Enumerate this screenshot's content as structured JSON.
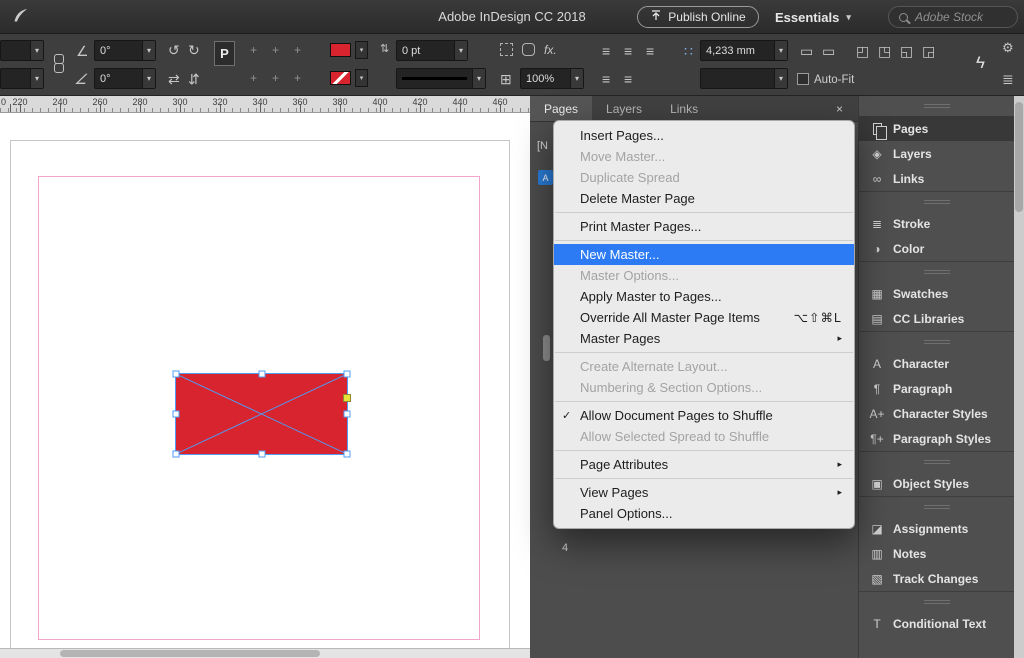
{
  "titlebar": {
    "title": "Adobe InDesign CC 2018",
    "publish_button": "Publish Online",
    "workspace": "Essentials",
    "stock_search_placeholder": "Adobe Stock"
  },
  "toolbar": {
    "rotation_angle": "0°",
    "shear_angle": "0°",
    "reference_badge": "P",
    "stroke_weight": "0 pt",
    "zoom_level": "100%",
    "corner_size": "4,233 mm",
    "autofit_label": "Auto-Fit",
    "effects_label": "fx."
  },
  "ruler": {
    "ticks": [
      "0",
      "220",
      "240",
      "260",
      "280",
      "300",
      "320",
      "340",
      "360",
      "380",
      "400",
      "420",
      "440",
      "460"
    ]
  },
  "menu": {
    "items": [
      {
        "label": "Insert Pages...",
        "state": "normal"
      },
      {
        "label": "Move Master...",
        "state": "disabled"
      },
      {
        "label": "Duplicate Spread",
        "state": "disabled"
      },
      {
        "label": "Delete Master Page",
        "state": "normal"
      },
      {
        "label": "Print Master Pages...",
        "state": "normal"
      },
      {
        "label": "New Master...",
        "state": "highlighted"
      },
      {
        "label": "Master Options...",
        "state": "disabled"
      },
      {
        "label": "Apply Master to Pages...",
        "state": "normal"
      },
      {
        "label": "Override All Master Page Items",
        "state": "normal",
        "shortcut": "⌥⇧⌘L"
      },
      {
        "label": "Master Pages",
        "state": "normal",
        "submenu": true
      },
      {
        "label": "Create Alternate Layout...",
        "state": "disabled"
      },
      {
        "label": "Numbering & Section Options...",
        "state": "disabled"
      },
      {
        "label": "Allow Document Pages to Shuffle",
        "state": "normal",
        "checked": true
      },
      {
        "label": "Allow Selected Spread to Shuffle",
        "state": "disabled"
      },
      {
        "label": "Page Attributes",
        "state": "normal",
        "submenu": true
      },
      {
        "label": "View Pages",
        "state": "normal",
        "submenu": true
      },
      {
        "label": "Panel Options...",
        "state": "normal"
      }
    ]
  },
  "dock": {
    "tabs": [
      {
        "label": "Pages",
        "active": true
      },
      {
        "label": "Layers",
        "active": false
      },
      {
        "label": "Links",
        "active": false
      }
    ],
    "partial_none_master": "[N",
    "partial_a_master": "A",
    "page_number": "4"
  },
  "panel_dock": {
    "groups": [
      {
        "items": [
          {
            "label": "Pages",
            "selected": true
          },
          {
            "label": "Layers"
          },
          {
            "label": "Links"
          }
        ]
      },
      {
        "items": [
          {
            "label": "Stroke"
          },
          {
            "label": "Color"
          }
        ]
      },
      {
        "items": [
          {
            "label": "Swatches"
          },
          {
            "label": "CC Libraries"
          }
        ]
      },
      {
        "items": [
          {
            "label": "Character"
          },
          {
            "label": "Paragraph"
          },
          {
            "label": "Character Styles"
          },
          {
            "label": "Paragraph Styles"
          }
        ]
      },
      {
        "items": [
          {
            "label": "Object Styles"
          }
        ]
      },
      {
        "items": [
          {
            "label": "Assignments"
          },
          {
            "label": "Notes"
          },
          {
            "label": "Track Changes"
          }
        ]
      },
      {
        "items": [
          {
            "label": "Conditional Text"
          }
        ]
      }
    ]
  },
  "icons": {
    "check": "✓",
    "submenu_arrow": "▸",
    "chevron_down": "▾",
    "close": "×",
    "collapse": "«",
    "spinner": "⇅",
    "rotate_ccw": "↺",
    "rotate_cw": "↻",
    "flip_h": "⇄",
    "flip_v": "⇵",
    "angle": "∠",
    "grid": "⊞",
    "align": "≡",
    "gap_dots": "∷",
    "rect": "▭",
    "plus": "+",
    "corner_tl": "◰",
    "corner_tr": "◳",
    "corner_bl": "◱",
    "corner_br": "◲",
    "gear": "⚙",
    "lightning": "ϟ",
    "layers": "◈",
    "links": "∞",
    "stroke": "≣",
    "color": "◑",
    "swatches": "▦",
    "cc_libraries": "▤",
    "character": "A",
    "paragraph": "¶",
    "character_styles": "A+",
    "paragraph_styles": "¶+",
    "object_styles": "▣",
    "assignments": "◪",
    "notes": "▥",
    "track_changes": "▧",
    "conditional_text": "T"
  },
  "colors": {
    "highlight_blue": "#2d7bf4",
    "selection_blue": "#4f9bf5",
    "frame_red": "#d8242f",
    "margin_pink": "#f2a4ca",
    "corner_yellow": "#e6e23a",
    "master_chip_blue": "#2a7cd8"
  }
}
